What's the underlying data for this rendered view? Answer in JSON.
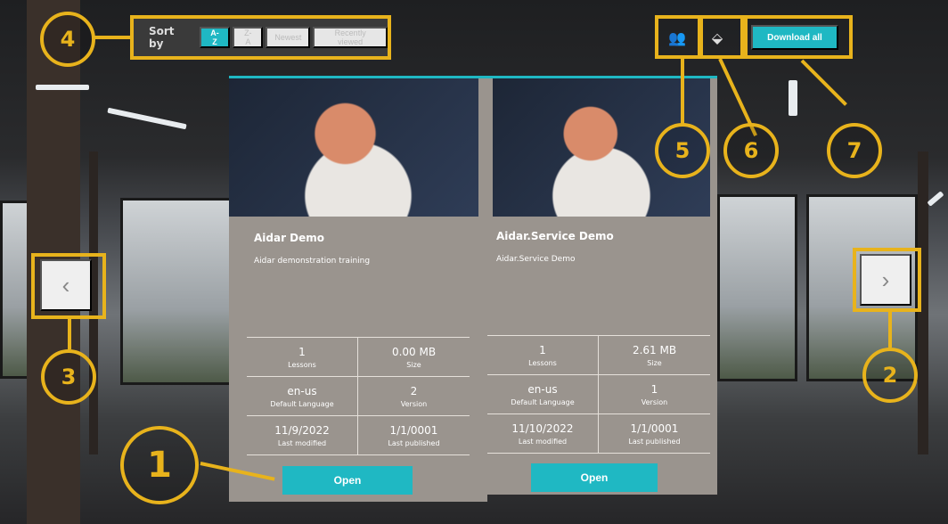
{
  "sort": {
    "label": "Sort by",
    "options": [
      "A-Z",
      "Z-A",
      "Newest",
      "Recently viewed"
    ],
    "selected": "A-Z"
  },
  "toolbar": {
    "users_icon": "users-icon",
    "layers_icon": "diamond-layers-icon",
    "download_all": "Download all"
  },
  "nav": {
    "prev": "‹",
    "next": "›"
  },
  "cards": [
    {
      "title": "Aidar Demo",
      "description": "Aidar demonstration training",
      "lessons": "1",
      "lessons_label": "Lessons",
      "size": "0.00 MB",
      "size_label": "Size",
      "language": "en-us",
      "language_label": "Default Language",
      "version": "2",
      "version_label": "Version",
      "modified": "11/9/2022",
      "modified_label": "Last modified",
      "published": "1/1/0001",
      "published_label": "Last published",
      "open": "Open"
    },
    {
      "title": "Aidar.Service Demo",
      "description": "Aidar.Service Demo",
      "lessons": "1",
      "lessons_label": "Lessons",
      "size": "2.61 MB",
      "size_label": "Size",
      "language": "en-us",
      "language_label": "Default Language",
      "version": "1",
      "version_label": "Version",
      "modified": "11/10/2022",
      "modified_label": "Last modified",
      "published": "1/1/0001",
      "published_label": "Last published",
      "open": "Open"
    }
  ],
  "annotations": [
    "1",
    "2",
    "3",
    "4",
    "5",
    "6",
    "7"
  ],
  "colors": {
    "accent": "#1fb8c3",
    "annotation": "#e8b31c",
    "card": "#9a948e"
  }
}
